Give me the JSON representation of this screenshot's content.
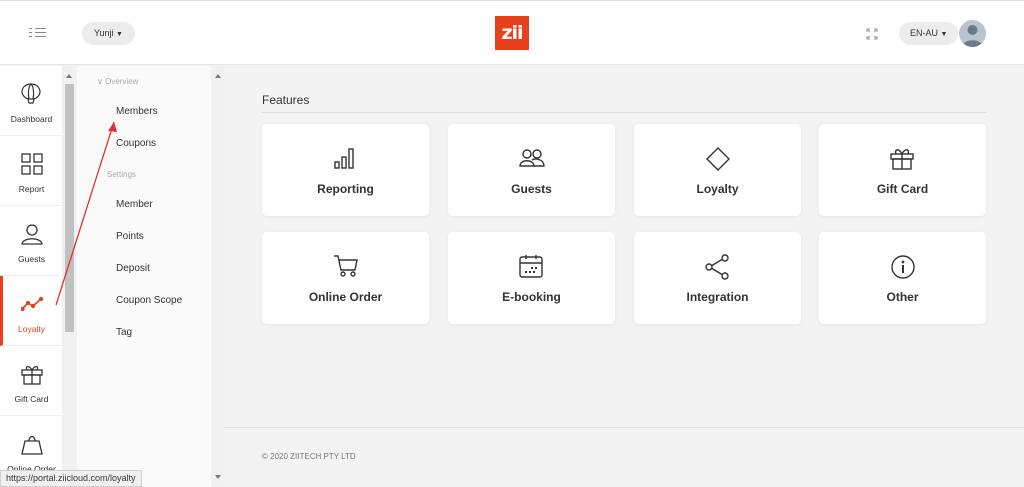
{
  "header": {
    "user_label": "Yunji",
    "logo_text": "zii",
    "lang_label": "EN-AU",
    "brand_color": "#e8401c"
  },
  "rail": {
    "items": [
      {
        "label": "Dashboard",
        "icon": "balloon-icon"
      },
      {
        "label": "Report",
        "icon": "grid-icon"
      },
      {
        "label": "Guests",
        "icon": "person-icon"
      },
      {
        "label": "Loyalty",
        "icon": "trend-icon",
        "active": true
      },
      {
        "label": "Gift Card",
        "icon": "gift-icon"
      },
      {
        "label": "Online Order",
        "icon": "bag-icon"
      }
    ]
  },
  "submenu": {
    "overview_label": "Overview",
    "settings_label": "Settings",
    "overview_items": [
      "Members",
      "Coupons"
    ],
    "settings_items": [
      "Member",
      "Points",
      "Deposit",
      "Coupon Scope",
      "Tag"
    ]
  },
  "main": {
    "features_title": "Features",
    "cards": [
      {
        "label": "Reporting",
        "icon": "bar-chart-icon"
      },
      {
        "label": "Guests",
        "icon": "users-icon"
      },
      {
        "label": "Loyalty",
        "icon": "diamond-icon"
      },
      {
        "label": "Gift Card",
        "icon": "gift-icon"
      },
      {
        "label": "Online Order",
        "icon": "cart-icon"
      },
      {
        "label": "E-booking",
        "icon": "calendar-icon"
      },
      {
        "label": "Integration",
        "icon": "share-icon"
      },
      {
        "label": "Other",
        "icon": "info-icon"
      }
    ],
    "footer": "© 2020 ZIITECH PTY LTD"
  },
  "status_bar": {
    "url": "https://portal.ziicloud.com/loyalty"
  }
}
